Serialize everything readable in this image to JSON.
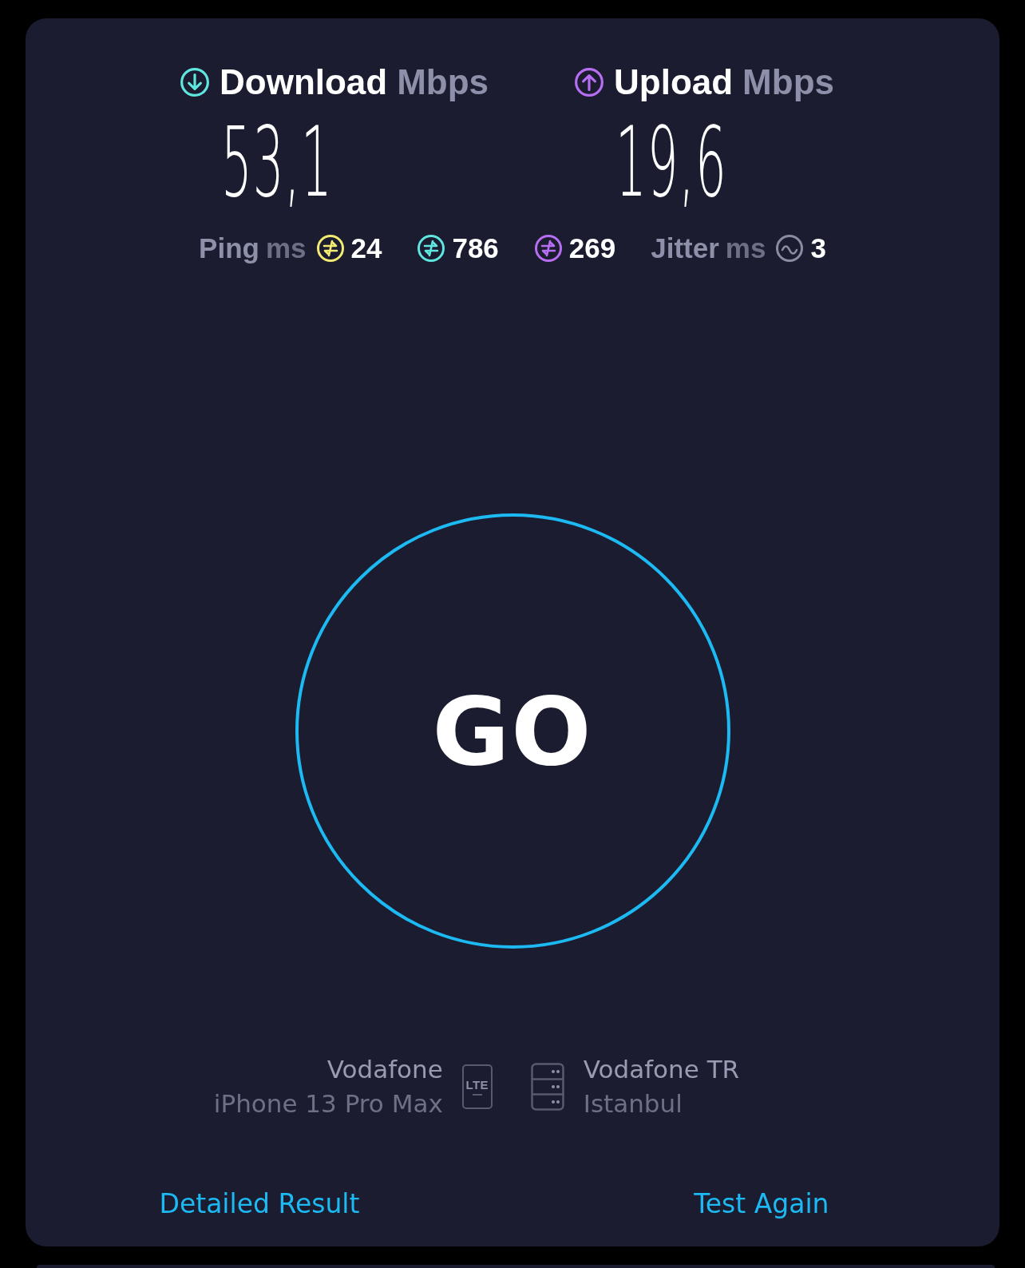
{
  "metrics": [
    {
      "kind": "download",
      "label": "Download",
      "unit": "Mbps",
      "value": "53,1",
      "color": "#5fe6df"
    },
    {
      "kind": "upload",
      "label": "Upload",
      "unit": "Mbps",
      "value": "19,6",
      "color": "#b86ef2"
    }
  ],
  "latency": [
    {
      "kind": "ping",
      "label": "Ping",
      "unit": "ms",
      "value": "24",
      "color": "#f3ea73"
    },
    {
      "kind": "ping",
      "value": "786",
      "color": "#5fe6df"
    },
    {
      "kind": "ping",
      "value": "269",
      "color": "#b86ef2"
    },
    {
      "kind": "jitter",
      "label": "Jitter",
      "unit": "ms",
      "value": "3",
      "color": "#8b8ca3"
    }
  ],
  "go_button": "GO",
  "provider": {
    "name": "Vodafone",
    "device": "iPhone 13 Pro Max",
    "network_badge": "LTE"
  },
  "server": {
    "name": "Vodafone TR",
    "location": "Istanbul"
  },
  "links": [
    "Detailed Result",
    "Test Again"
  ]
}
